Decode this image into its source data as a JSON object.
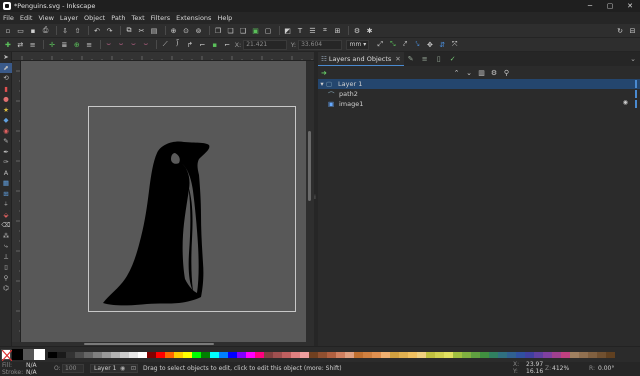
{
  "window": {
    "title": "*Penguins.svg - Inkscape",
    "controls": [
      "─",
      "▢",
      "✕"
    ]
  },
  "menu": [
    "File",
    "Edit",
    "View",
    "Layer",
    "Object",
    "Path",
    "Text",
    "Filters",
    "Extensions",
    "Help"
  ],
  "control_bar": {
    "x_label": "X:",
    "x_value": "21.421",
    "y_label": "Y:",
    "y_value": "33.604",
    "unit": "mm"
  },
  "dock": {
    "tab_label": "Layers and Objects",
    "tab_close": "✕",
    "tree": [
      {
        "label": "Layer 1",
        "expander": "▾",
        "icon": "▢",
        "selected": true
      },
      {
        "label": "path2",
        "expander": "",
        "icon": "⌒",
        "selected": false
      },
      {
        "label": "image1",
        "expander": "",
        "icon": "▣",
        "selected": false,
        "visibility": "👁"
      }
    ]
  },
  "status": {
    "fill_label": "Fill:",
    "fill_value": "N/A",
    "stroke_label": "Stroke:",
    "stroke_value": "N/A",
    "opacity_label": "O:",
    "opacity_value": "100",
    "layer": "Layer 1",
    "message": "Drag to select objects to edit, click to edit this object (more: Shift)",
    "x_label": "X:",
    "x_value": "23.97",
    "y_label": "Y:",
    "y_value": "16.16",
    "zoom_label": "Z:",
    "zoom_value": "412%",
    "rotate_label": "R:",
    "rotate_value": "0.00°"
  },
  "colors": {
    "accent": "#4a8ad0",
    "canvas": "#585858",
    "selection": "#24466e"
  },
  "palette": [
    "#000000",
    "#1a1a1a",
    "#333333",
    "#4d4d4d",
    "#666666",
    "#808080",
    "#999999",
    "#b3b3b3",
    "#cccccc",
    "#e6e6e6",
    "#ffffff",
    "#800000",
    "#ff0000",
    "#ff6600",
    "#ffcc00",
    "#ffff00",
    "#00ff00",
    "#008000",
    "#00ffff",
    "#0080ff",
    "#0000ff",
    "#8000ff",
    "#ff00ff",
    "#ff0080",
    "#804040",
    "#a05050",
    "#c06060",
    "#e08080",
    "#f0a0a0",
    "#704020",
    "#905030",
    "#b06040",
    "#d08060",
    "#e0a080",
    "#c07030",
    "#d08040",
    "#e09050",
    "#f0b070",
    "#d0a040",
    "#e0b050",
    "#f0c060",
    "#f0d080",
    "#c0c040",
    "#d0d050",
    "#e0e060",
    "#a0c040",
    "#80b040",
    "#60a040",
    "#409040",
    "#308060",
    "#307080",
    "#306090",
    "#3050a0",
    "#4040a0",
    "#6040a0",
    "#8040a0",
    "#a04090",
    "#c04080",
    "#a08060",
    "#907050",
    "#806040",
    "#705030",
    "#604020"
  ]
}
